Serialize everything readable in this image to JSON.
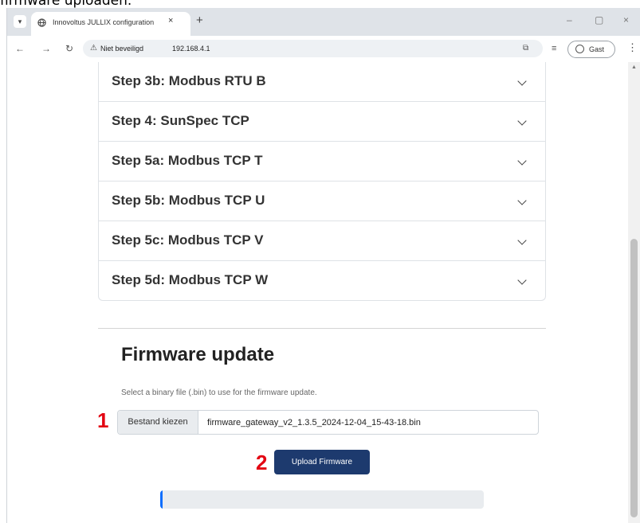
{
  "caption": "firmware uploaden.",
  "browser": {
    "tab_title": "Innovoltus JULLIX configuration",
    "tab_close": "×",
    "new_tab": "+",
    "security_label": "Niet beveiligd",
    "url": "192.168.4.1",
    "profile_label": "Gast",
    "controls": {
      "minimize": "–",
      "maximize": "▢",
      "close": "×"
    }
  },
  "accordion": {
    "items": [
      {
        "label": "Step 3b: Modbus RTU B"
      },
      {
        "label": "Step 4: SunSpec TCP"
      },
      {
        "label": "Step 5a: Modbus TCP T"
      },
      {
        "label": "Step 5b: Modbus TCP U"
      },
      {
        "label": "Step 5c: Modbus TCP V"
      },
      {
        "label": "Step 5d: Modbus TCP W"
      }
    ]
  },
  "firmware": {
    "title": "Firmware update",
    "help_text": "Select a binary file (.bin) to use for the firmware update.",
    "file_button_label": "Bestand kiezen",
    "file_name": "firmware_gateway_v2_1.3.5_2024-12-04_15-43-18.bin",
    "upload_label": "Upload Firmware",
    "progress_fraction": 0.008
  },
  "annotations": {
    "marker1": "1",
    "marker2": "2",
    "color": "#e30613"
  },
  "colors": {
    "upload_button": "#1d3a6e",
    "progress_fill": "#0d6efd"
  }
}
